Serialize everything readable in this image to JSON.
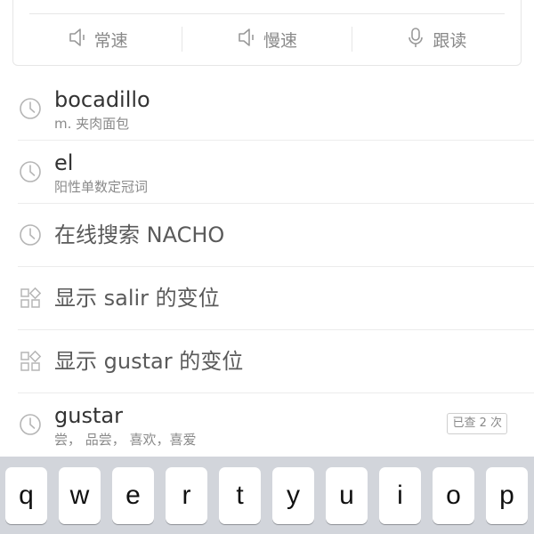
{
  "audio": {
    "normal_label": "常速",
    "slow_label": "慢速",
    "follow_label": "跟读"
  },
  "history": [
    {
      "type": "word",
      "icon": "clock-icon",
      "word": "bocadillo",
      "definition": "m. 夹肉面包"
    },
    {
      "type": "word",
      "icon": "clock-icon",
      "word": "el",
      "definition": "阳性单数定冠词"
    },
    {
      "type": "action",
      "icon": "clock-icon",
      "text": "在线搜索 NACHO"
    },
    {
      "type": "action",
      "icon": "grid-icon",
      "text": "显示 salir 的变位"
    },
    {
      "type": "action",
      "icon": "grid-icon",
      "text": "显示 gustar 的变位"
    },
    {
      "type": "word",
      "icon": "clock-icon",
      "word": "gustar",
      "definition": "尝， 品尝， 喜欢，喜爱",
      "badge": "已查 2 次"
    }
  ],
  "keyboard": {
    "keys": [
      "q",
      "w",
      "e",
      "r",
      "t",
      "y",
      "u",
      "i",
      "o",
      "p"
    ],
    "background": "#d2d5db"
  }
}
